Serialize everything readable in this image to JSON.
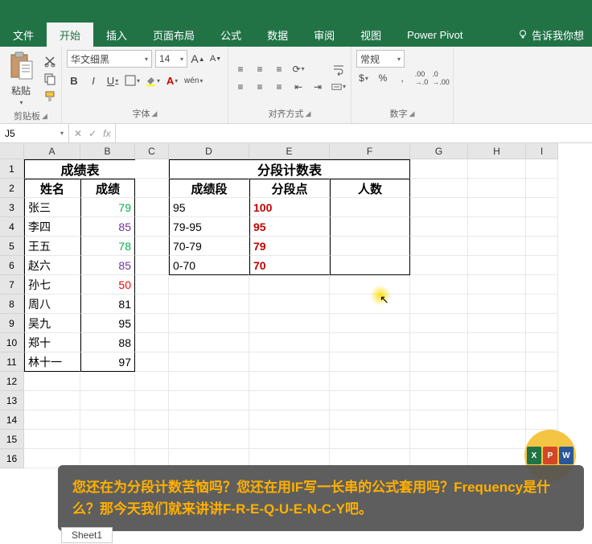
{
  "ribbon": {
    "tabs": [
      "文件",
      "开始",
      "插入",
      "页面布局",
      "公式",
      "数据",
      "审阅",
      "视图",
      "Power Pivot"
    ],
    "active_tab": "开始",
    "tell_me": "告诉我你想",
    "groups": {
      "clipboard": {
        "label": "剪贴板",
        "paste": "粘贴"
      },
      "font": {
        "label": "字体",
        "name": "华文细黑",
        "size": "14",
        "bold": "B",
        "italic": "I",
        "underline": "U",
        "wen": "wén"
      },
      "alignment": {
        "label": "对齐方式"
      },
      "number": {
        "label": "数字",
        "format": "常规"
      }
    }
  },
  "formula_bar": {
    "name_box": "J5",
    "fx": "fx",
    "value": ""
  },
  "columns": [
    "A",
    "B",
    "C",
    "D",
    "E",
    "F",
    "G",
    "H",
    "I"
  ],
  "row_count": 16,
  "sheet": {
    "tab": "Sheet1"
  },
  "table1": {
    "title": "成绩表",
    "headers": [
      "姓名",
      "成绩"
    ],
    "rows": [
      {
        "name": "张三",
        "score": "79",
        "cls": "score-green"
      },
      {
        "name": "李四",
        "score": "85",
        "cls": "score-purple"
      },
      {
        "name": "王五",
        "score": "78",
        "cls": "score-green"
      },
      {
        "name": "赵六",
        "score": "85",
        "cls": "score-purple"
      },
      {
        "name": "孙七",
        "score": "50",
        "cls": "score-red"
      },
      {
        "name": "周八",
        "score": "81",
        "cls": "score-black"
      },
      {
        "name": "吴九",
        "score": "95",
        "cls": "score-black"
      },
      {
        "name": "郑十",
        "score": "88",
        "cls": "score-black"
      },
      {
        "name": "林十一",
        "score": "97",
        "cls": "score-black"
      }
    ]
  },
  "table2": {
    "title": "分段计数表",
    "headers": [
      "成绩段",
      "分段点",
      "人数"
    ],
    "rows": [
      {
        "seg": "95",
        "pt": "100"
      },
      {
        "seg": "79-95",
        "pt": "95"
      },
      {
        "seg": "70-79",
        "pt": "79"
      },
      {
        "seg": "0-70",
        "pt": "70"
      }
    ]
  },
  "overlay": {
    "text": "您还在为分段计数苦恼吗？您还在用IF写一长串的公式套用吗？Frequency是什么？那今天我们就来讲讲F-R-E-Q-U-E-N-C-Y吧。"
  },
  "icons": {
    "excel": "X",
    "ppt": "P",
    "word": "W"
  }
}
